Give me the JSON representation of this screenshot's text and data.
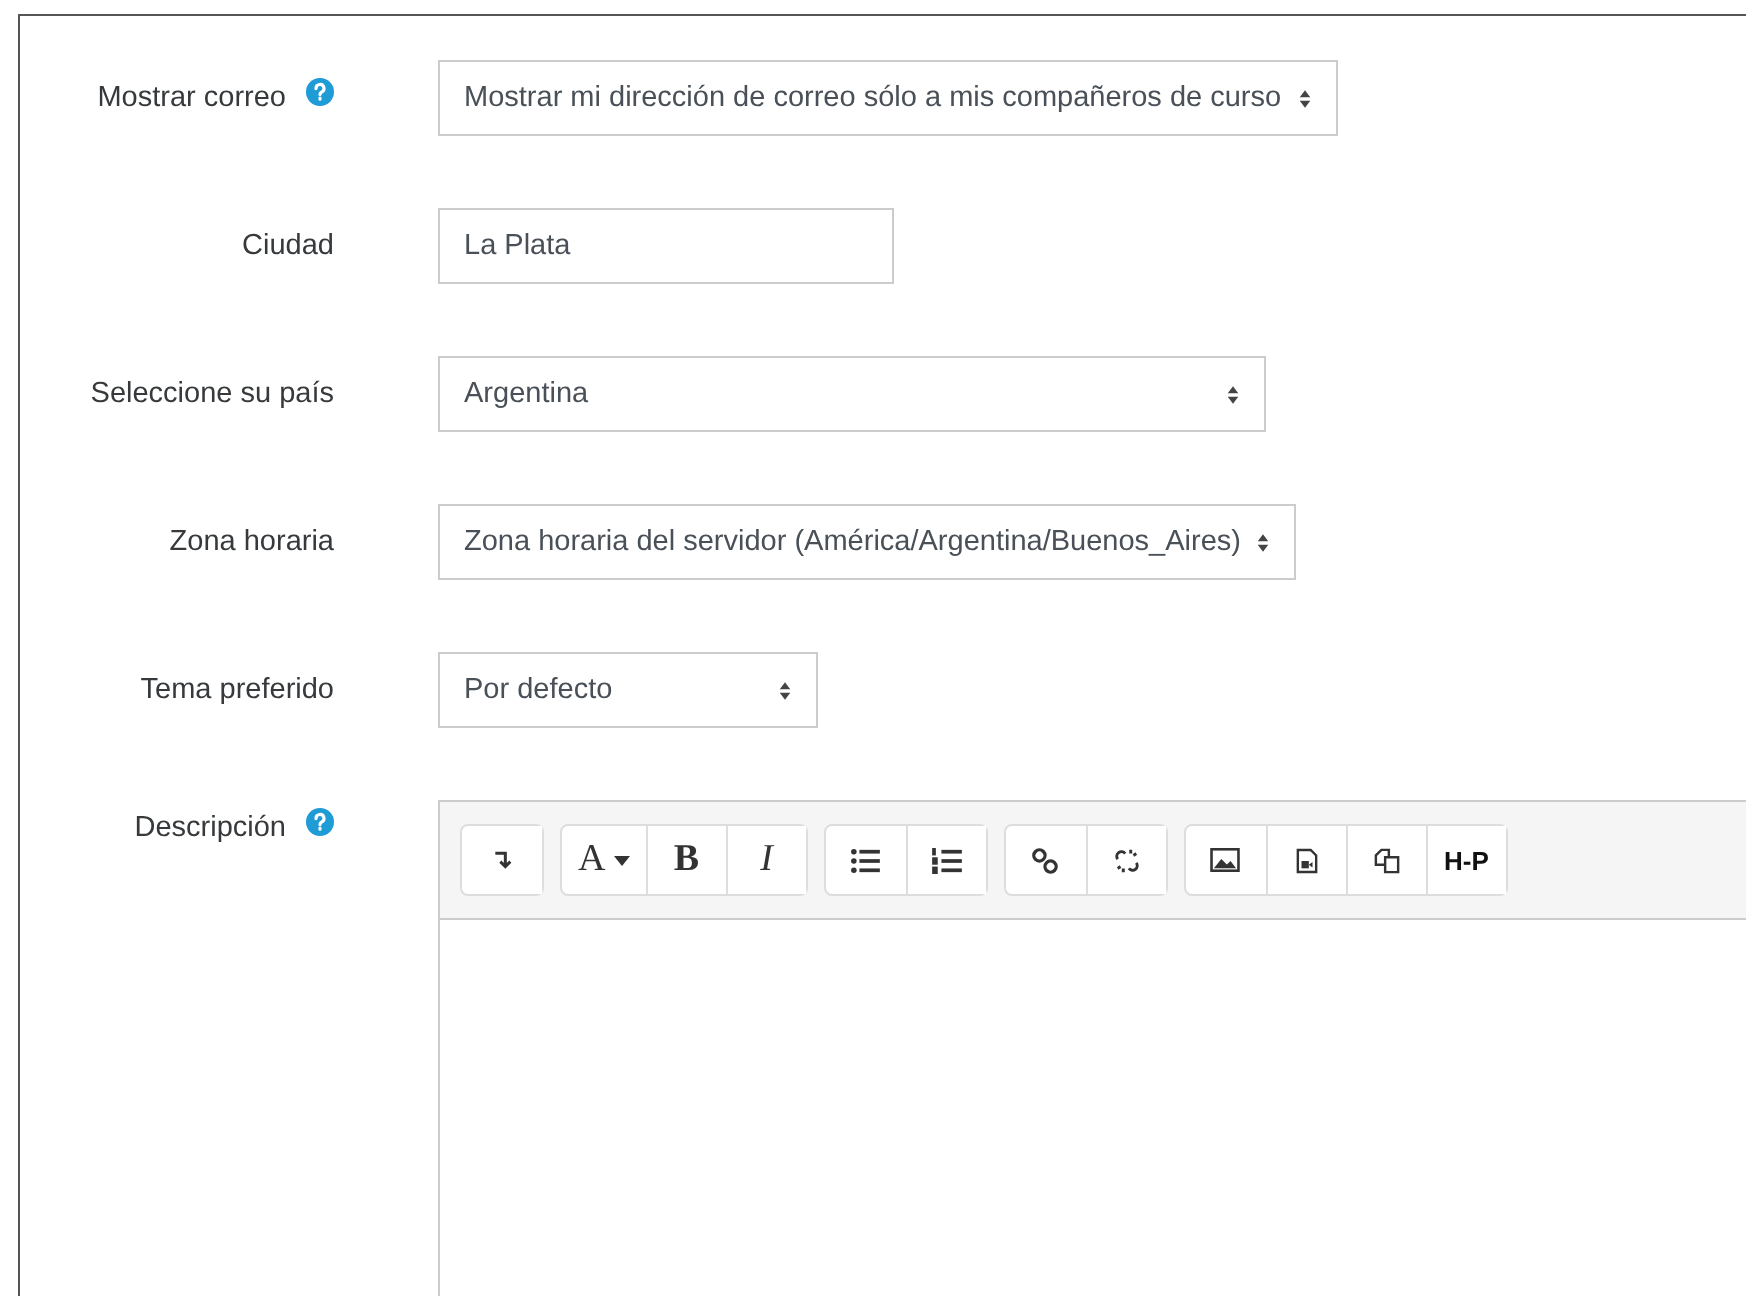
{
  "fields": [
    {
      "label": "Mostrar correo",
      "help": true,
      "kind": "select",
      "value": "Mostrar mi dirección de correo sólo a mis compañeros de curso"
    },
    {
      "label": "Ciudad",
      "help": false,
      "kind": "text",
      "value": "La Plata"
    },
    {
      "label": "Seleccione su país",
      "help": false,
      "kind": "select",
      "value": "Argentina"
    },
    {
      "label": "Zona horaria",
      "help": false,
      "kind": "select",
      "value": "Zona horaria del servidor (América/Argentina/Buenos_Aires)"
    },
    {
      "label": "Tema preferido",
      "help": false,
      "kind": "select",
      "value": "Por defecto"
    }
  ],
  "editor": {
    "label": "Descripción",
    "help": true,
    "toolbar": [
      [
        {
          "kind": "collapse"
        }
      ],
      [
        {
          "kind": "font",
          "label": "A"
        },
        {
          "kind": "bold",
          "label": "B"
        },
        {
          "kind": "italic",
          "label": "I"
        }
      ],
      [
        {
          "kind": "bullets"
        },
        {
          "kind": "numbers"
        }
      ],
      [
        {
          "kind": "link"
        },
        {
          "kind": "unlink"
        }
      ],
      [
        {
          "kind": "image"
        },
        {
          "kind": "media"
        },
        {
          "kind": "copy"
        },
        {
          "kind": "h5p",
          "label": "H-P"
        }
      ]
    ]
  }
}
